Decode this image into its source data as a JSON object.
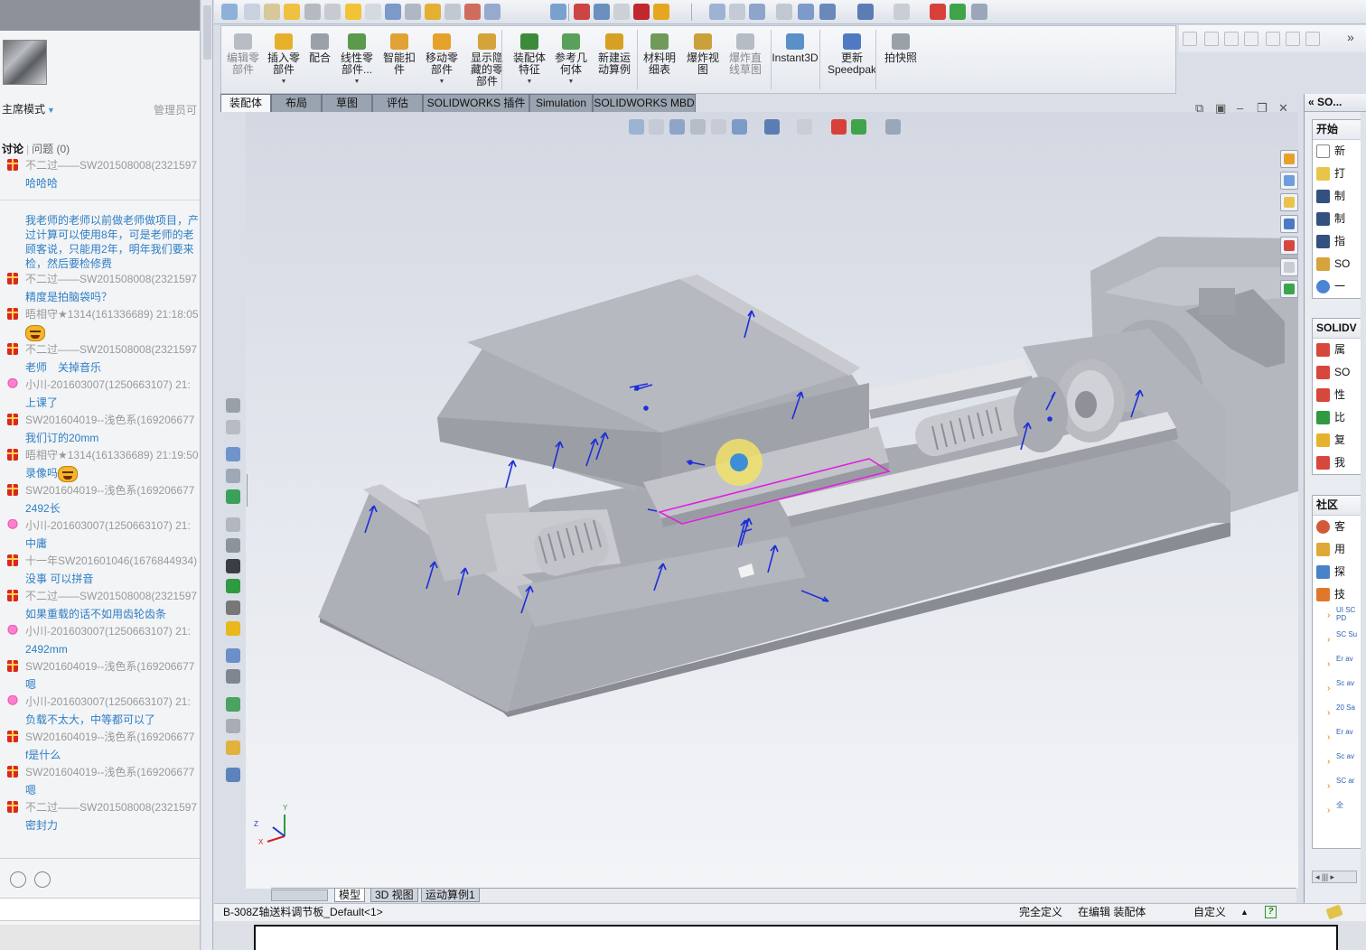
{
  "chat": {
    "mode_label": "主席模式",
    "admin_label": "管理员可",
    "tab_discussion": "讨论",
    "tab_questions": "问题 (0)",
    "messages": [
      {
        "sender": "不二过——SW201508008(2321597",
        "text": "哈哈哈",
        "icon": "gift"
      },
      {
        "sender": "",
        "text": "我老师的老师以前做老师做项目，产过计算可以使用8年，可是老师的老顾客说，只能用2年，明年我们要来检，然后要检修费",
        "icon": "none"
      },
      {
        "sender": "不二过——SW201508008(2321597",
        "text": "精度是拍脑袋吗？",
        "icon": "gift"
      },
      {
        "sender": "晤相守★1314(161336689) 21:18:05",
        "text": "",
        "icon": "gift",
        "emoji": true
      },
      {
        "sender": "不二过——SW201508008(2321597",
        "text": "老师　关掉音乐",
        "icon": "gift"
      },
      {
        "sender": "小川-201603007(1250663107) 21:",
        "text": "上课了",
        "icon": "flower"
      },
      {
        "sender": "SW201604019--浅色系(169206677",
        "text": "我们订的20mm",
        "icon": "gift"
      },
      {
        "sender": "晤相守★1314(161336689) 21:19:50",
        "text": "录像吗",
        "icon": "gift",
        "emoji": true
      },
      {
        "sender": "SW201604019--浅色系(169206677",
        "text": "2492长",
        "icon": "gift"
      },
      {
        "sender": "小川-201603007(1250663107) 21:",
        "text": "中庸",
        "icon": "flower"
      },
      {
        "sender": "十一年SW201601046(1676844934)",
        "text": "没事 可以拼音",
        "icon": "gift"
      },
      {
        "sender": "不二过——SW201508008(2321597",
        "text": "如果重载的话不如用齿轮齿条",
        "icon": "gift"
      },
      {
        "sender": "小川-201603007(1250663107) 21:",
        "text": "2492mm",
        "icon": "flower"
      },
      {
        "sender": "SW201604019--浅色系(169206677",
        "text": "嗯",
        "icon": "gift"
      },
      {
        "sender": "小川-201603007(1250663107) 21:",
        "text": "负载不太大，中等都可以了",
        "icon": "flower"
      },
      {
        "sender": "SW201604019--浅色系(169206677",
        "text": "f是什么",
        "icon": "gift"
      },
      {
        "sender": "SW201604019--浅色系(169206677",
        "text": "嗯",
        "icon": "gift"
      },
      {
        "sender": "不二过——SW201508008(2321597",
        "text": "密封力",
        "icon": "gift"
      }
    ]
  },
  "commandmanager": {
    "buttons": [
      {
        "label": "编辑零\n部件",
        "disabled": true
      },
      {
        "label": "插入零\n部件",
        "disabled": false,
        "dropdown": true
      },
      {
        "label": "配合",
        "disabled": false
      },
      {
        "label": "线性零\n部件...",
        "disabled": false,
        "dropdown": true
      },
      {
        "label": "智能扣\n件",
        "disabled": false
      },
      {
        "label": "移动零\n部件",
        "disabled": false,
        "dropdown": true
      },
      {
        "label": "显示隐\n藏的零\n部件",
        "disabled": false
      },
      {
        "label": "装配体\n特征",
        "disabled": false,
        "dropdown": true
      },
      {
        "label": "参考几\n何体",
        "disabled": false,
        "dropdown": true
      },
      {
        "label": "新建运\n动算例",
        "disabled": false
      },
      {
        "label": "材料明\n细表",
        "disabled": false
      },
      {
        "label": "爆炸视\n图",
        "disabled": false
      },
      {
        "label": "爆炸直\n线草图",
        "disabled": true
      },
      {
        "label": "Instant3D",
        "disabled": false
      },
      {
        "label": "更新\nSpeedpak",
        "disabled": false
      },
      {
        "label": "拍快照",
        "disabled": false
      }
    ],
    "tabs": [
      "装配体",
      "布局",
      "草图",
      "评估",
      "SOLIDWORKS 插件",
      "Simulation",
      "SOLIDWORKS MBD"
    ],
    "active_tab": "装配体"
  },
  "bottom_tabs": [
    "模型",
    "3D 视图",
    "运动算例1"
  ],
  "status": {
    "document": "B-308Z轴送料调节板_Default<1>",
    "definition": "完全定义",
    "editing": "在编辑 装配体",
    "units": "自定义",
    "help": "?"
  },
  "taskpane": {
    "title": "SO...",
    "start_header": "开始",
    "start_items": [
      "新",
      "打",
      "制",
      "制",
      "指",
      "SO",
      "一"
    ],
    "solidworks_header": "SOLIDV",
    "solidworks_items": [
      "属",
      "SO",
      "性",
      "比",
      "复",
      "我"
    ],
    "community_header": "社区",
    "community_items": [
      "客",
      "用",
      "探",
      "技"
    ],
    "news": [
      "UI SC PD",
      "SC Su",
      "Er av",
      "Sc av",
      "20 Sa",
      "Er av",
      "Sc av",
      "SC ar"
    ],
    "more": "全"
  },
  "triad": {
    "x": "X",
    "y": "Y",
    "z": "Z"
  },
  "colors": {
    "accent_link": "#2d7ec4",
    "model_gray": "#a5a7ae",
    "selection_magenta": "#e020e0",
    "mate_arrow_blue": "#1d2fd8"
  }
}
